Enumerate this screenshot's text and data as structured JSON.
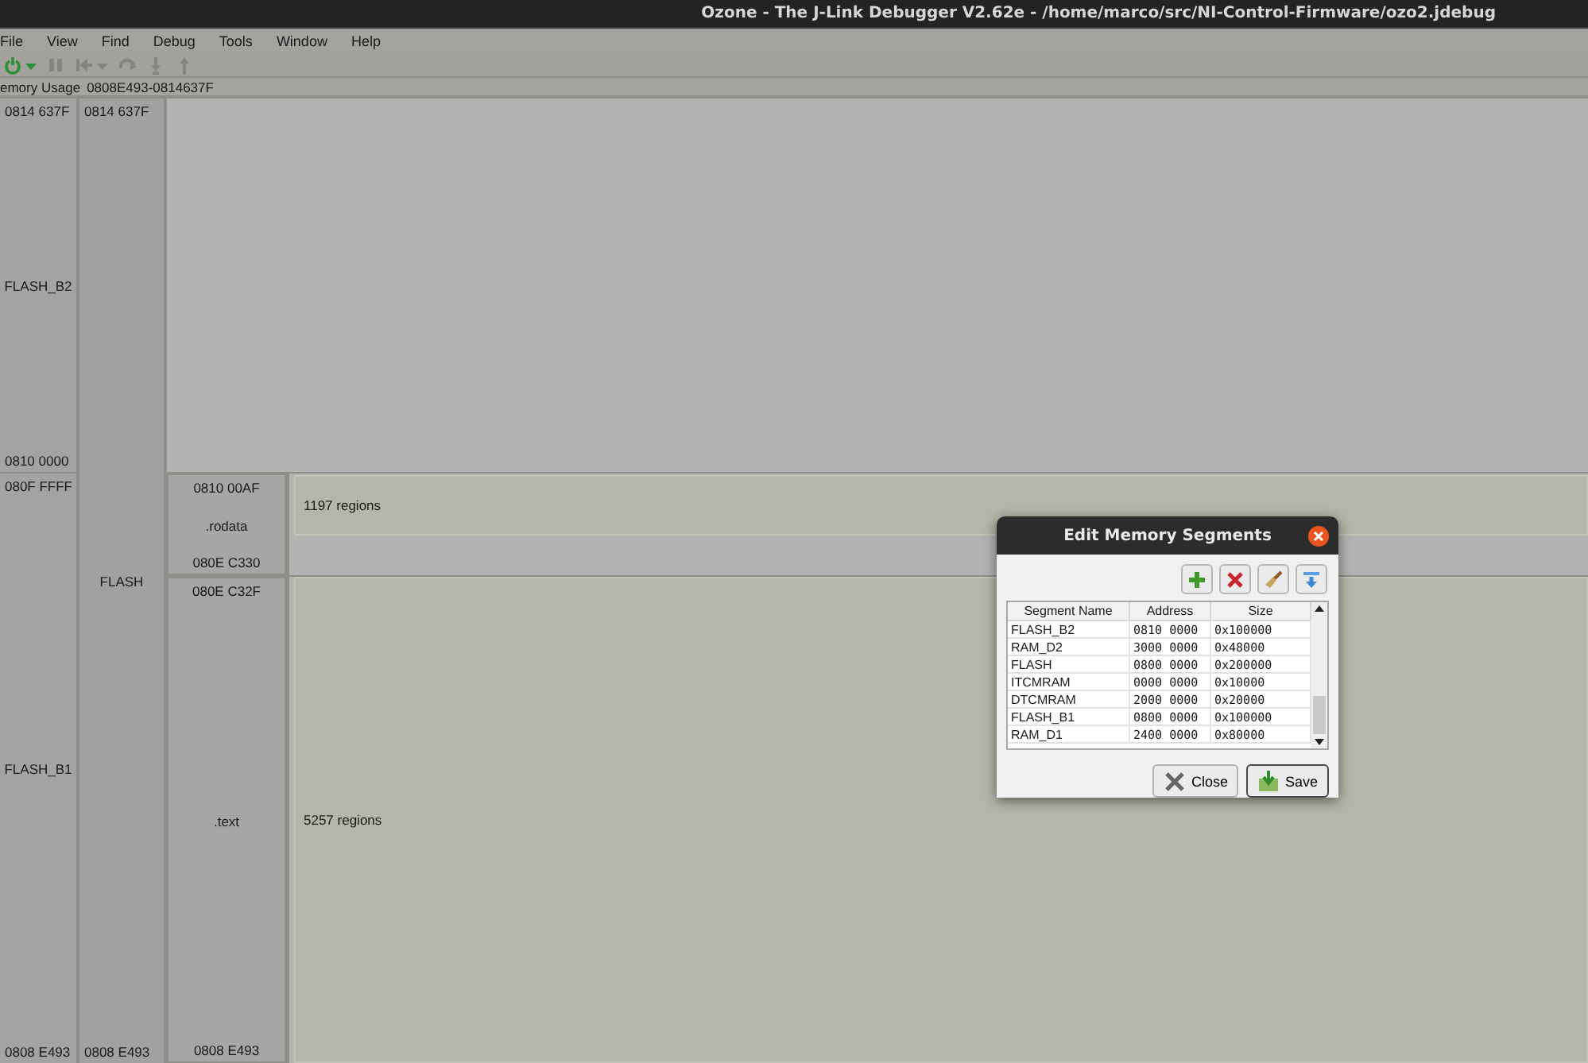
{
  "window": {
    "title": "Ozone - The J-Link Debugger V2.62e - /home/marco/src/NI-Control-Firmware/ozo2.jdebug"
  },
  "menu": [
    {
      "label": "File"
    },
    {
      "label": "View"
    },
    {
      "label": "Find"
    },
    {
      "label": "Debug"
    },
    {
      "label": "Tools"
    },
    {
      "label": "Window"
    },
    {
      "label": "Help"
    }
  ],
  "toolbar": [
    {
      "kind": "power",
      "disabled": false,
      "dropdown": true
    },
    {
      "kind": "pause",
      "disabled": true,
      "dropdown": false
    },
    {
      "kind": "reset",
      "disabled": true,
      "dropdown": true
    },
    {
      "kind": "step-over",
      "disabled": true,
      "dropdown": false
    },
    {
      "kind": "step-into",
      "disabled": true,
      "dropdown": false
    },
    {
      "kind": "step-out",
      "disabled": true,
      "dropdown": false
    }
  ],
  "memory_usage": {
    "label": "emory Usage",
    "range": "0808E493-0814637F"
  },
  "map": {
    "regions": [
      {
        "name": "FLASH_B2",
        "top": "0814 637F",
        "bottom": "0810 0000"
      },
      {
        "name": "FLASH_B1",
        "top": "080F FFFF",
        "bottom": "0808 E493"
      }
    ],
    "memories": [
      {
        "name": "FLASH",
        "top": "0814 637F",
        "bottom": "0808 E493"
      }
    ],
    "sections": [
      {
        "name": ".rodata",
        "top": "0810 00AF",
        "bottom": "080E C330",
        "count": "1197 regions"
      },
      {
        "name": ".text",
        "top": "080E C32F",
        "bottom": "0808 E493",
        "count": "5257 regions"
      }
    ]
  },
  "dialog": {
    "title": "Edit Memory Segments",
    "tools": [
      {
        "kind": "add"
      },
      {
        "kind": "delete"
      },
      {
        "kind": "clear"
      },
      {
        "kind": "import"
      }
    ],
    "columns": [
      "Segment Name",
      "Address",
      "Size"
    ],
    "rows": [
      [
        "FLASH_B2",
        "0810 0000",
        "0x100000"
      ],
      [
        "RAM_D2",
        "3000 0000",
        "0x48000"
      ],
      [
        "FLASH",
        "0800 0000",
        "0x200000"
      ],
      [
        "ITCMRAM",
        "0000 0000",
        "0x10000"
      ],
      [
        "DTCMRAM",
        "2000 0000",
        "0x20000"
      ],
      [
        "FLASH_B1",
        "0800 0000",
        "0x100000"
      ],
      [
        "RAM_D1",
        "2400 0000",
        "0x80000"
      ]
    ],
    "buttons": [
      {
        "kind": "close",
        "label": "Close"
      },
      {
        "kind": "save",
        "label": "Save"
      }
    ]
  }
}
